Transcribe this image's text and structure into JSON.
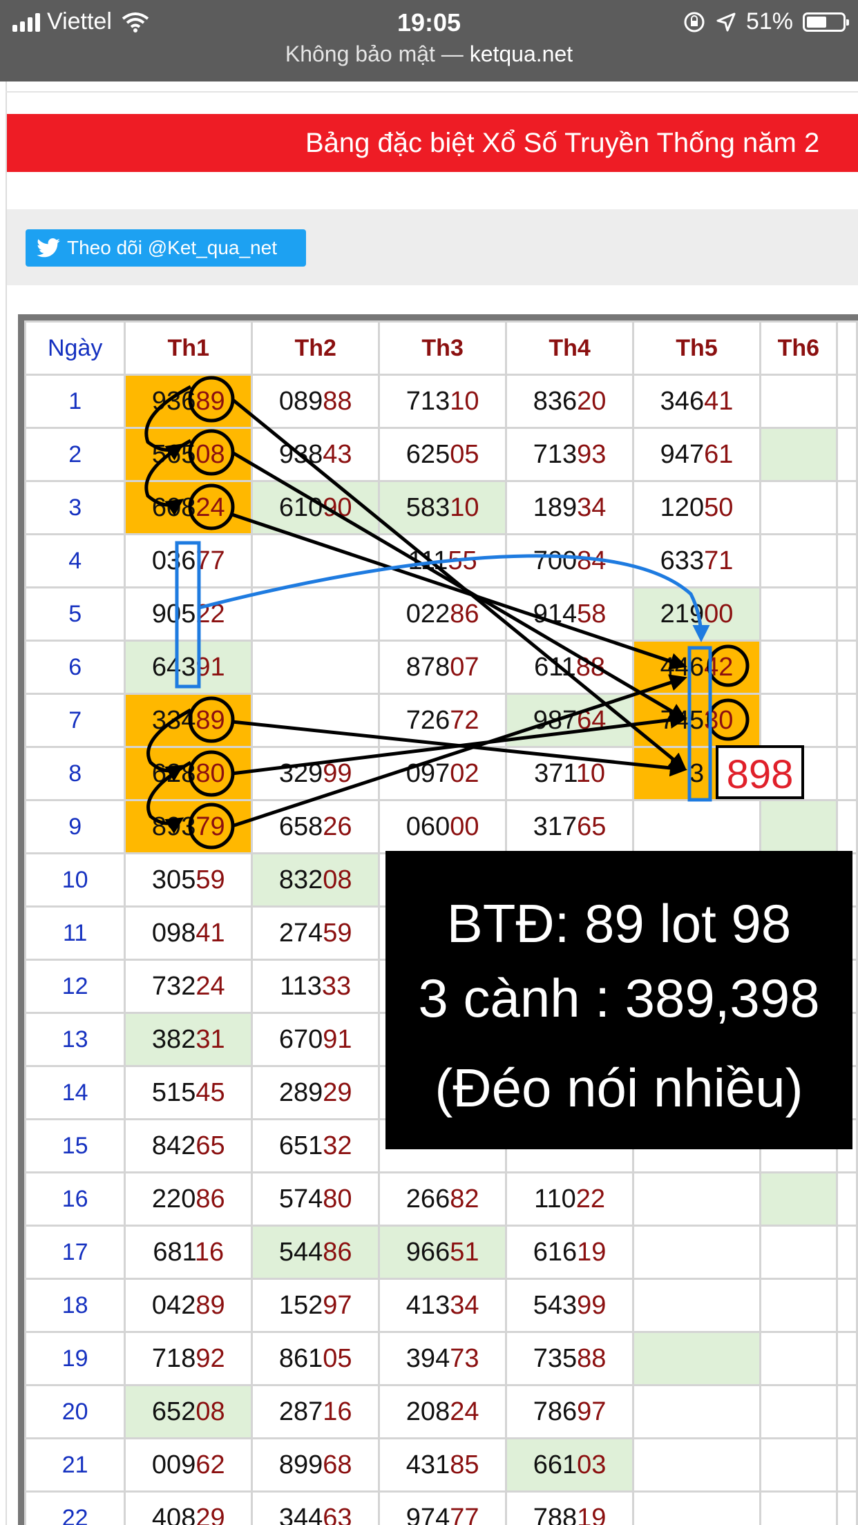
{
  "status_bar": {
    "carrier": "Viettel",
    "time": "19:05",
    "battery": "51%",
    "battery_level": 0.51
  },
  "address_bar": {
    "security": "Không bảo mật —",
    "domain": "ketqua.net"
  },
  "banner": {
    "title": "Bảng đặc biệt Xổ Số Truyền Thống năm 2"
  },
  "follow_button": {
    "label": "Theo dõi @Ket_qua_net"
  },
  "table": {
    "headers": [
      "Ngày",
      "Th1",
      "Th2",
      "Th3",
      "Th4",
      "Th5",
      "Th6"
    ],
    "rows": [
      {
        "day": "1",
        "cells": [
          [
            "936",
            "89",
            "orange"
          ],
          [
            "089",
            "88",
            ""
          ],
          [
            "713",
            "10",
            ""
          ],
          [
            "836",
            "20",
            ""
          ],
          [
            "346",
            "41",
            ""
          ],
          [
            "",
            "",
            ""
          ]
        ]
      },
      {
        "day": "2",
        "cells": [
          [
            "565",
            "08",
            "orange"
          ],
          [
            "938",
            "43",
            ""
          ],
          [
            "625",
            "05",
            ""
          ],
          [
            "713",
            "93",
            ""
          ],
          [
            "947",
            "61",
            ""
          ],
          [
            "",
            "",
            "green"
          ]
        ]
      },
      {
        "day": "3",
        "cells": [
          [
            "608",
            "24",
            "orange"
          ],
          [
            "610",
            "90",
            "green"
          ],
          [
            "583",
            "10",
            "green"
          ],
          [
            "189",
            "34",
            ""
          ],
          [
            "120",
            "50",
            ""
          ],
          [
            "",
            "",
            ""
          ]
        ]
      },
      {
        "day": "4",
        "cells": [
          [
            "036",
            "77",
            ""
          ],
          [
            "",
            "",
            ""
          ],
          [
            "111",
            "55",
            ""
          ],
          [
            "700",
            "84",
            ""
          ],
          [
            "633",
            "71",
            ""
          ],
          [
            "",
            "",
            ""
          ]
        ]
      },
      {
        "day": "5",
        "cells": [
          [
            "905",
            "22",
            ""
          ],
          [
            "",
            "",
            ""
          ],
          [
            "022",
            "86",
            ""
          ],
          [
            "914",
            "58",
            ""
          ],
          [
            "219",
            "00",
            "green"
          ],
          [
            "",
            "",
            ""
          ]
        ]
      },
      {
        "day": "6",
        "cells": [
          [
            "643",
            "91",
            "green"
          ],
          [
            "",
            "",
            ""
          ],
          [
            "878",
            "07",
            ""
          ],
          [
            "611",
            "88",
            ""
          ],
          [
            "446",
            "42",
            "orange"
          ],
          [
            "",
            "",
            ""
          ]
        ]
      },
      {
        "day": "7",
        "cells": [
          [
            "334",
            "89",
            "orange"
          ],
          [
            "",
            "",
            ""
          ],
          [
            "726",
            "72",
            ""
          ],
          [
            "987",
            "64",
            "green"
          ],
          [
            "745",
            "30",
            "orange"
          ],
          [
            "",
            "",
            ""
          ]
        ]
      },
      {
        "day": "8",
        "cells": [
          [
            "628",
            "80",
            "orange"
          ],
          [
            "329",
            "99",
            ""
          ],
          [
            "097",
            "02",
            ""
          ],
          [
            "371",
            "10",
            ""
          ],
          [
            "3",
            "",
            "orange"
          ],
          [
            "",
            "",
            ""
          ]
        ]
      },
      {
        "day": "9",
        "cells": [
          [
            "893",
            "79",
            "orange"
          ],
          [
            "658",
            "26",
            ""
          ],
          [
            "060",
            "00",
            ""
          ],
          [
            "317",
            "65",
            ""
          ],
          [
            "",
            "",
            ""
          ],
          [
            "",
            "",
            "green"
          ]
        ]
      },
      {
        "day": "10",
        "cells": [
          [
            "305",
            "59",
            ""
          ],
          [
            "832",
            "08",
            "green"
          ],
          [
            "",
            "",
            ""
          ],
          [
            "",
            "",
            ""
          ],
          [
            "",
            "",
            ""
          ],
          [
            "",
            "",
            ""
          ]
        ]
      },
      {
        "day": "11",
        "cells": [
          [
            "098",
            "41",
            ""
          ],
          [
            "274",
            "59",
            ""
          ],
          [
            "",
            "",
            ""
          ],
          [
            "",
            "",
            ""
          ],
          [
            "",
            "",
            ""
          ],
          [
            "",
            "",
            ""
          ]
        ]
      },
      {
        "day": "12",
        "cells": [
          [
            "732",
            "24",
            ""
          ],
          [
            "113",
            "33",
            ""
          ],
          [
            "",
            "",
            ""
          ],
          [
            "",
            "",
            ""
          ],
          [
            "",
            "",
            ""
          ],
          [
            "",
            "",
            ""
          ]
        ]
      },
      {
        "day": "13",
        "cells": [
          [
            "382",
            "31",
            "green"
          ],
          [
            "670",
            "91",
            ""
          ],
          [
            "",
            "",
            ""
          ],
          [
            "",
            "",
            ""
          ],
          [
            "",
            "",
            ""
          ],
          [
            "",
            "",
            ""
          ]
        ]
      },
      {
        "day": "14",
        "cells": [
          [
            "515",
            "45",
            ""
          ],
          [
            "289",
            "29",
            ""
          ],
          [
            "",
            "",
            ""
          ],
          [
            "",
            "",
            ""
          ],
          [
            "",
            "",
            ""
          ],
          [
            "",
            "",
            ""
          ]
        ]
      },
      {
        "day": "15",
        "cells": [
          [
            "842",
            "65",
            ""
          ],
          [
            "651",
            "32",
            ""
          ],
          [
            "",
            "",
            ""
          ],
          [
            "",
            "",
            ""
          ],
          [
            "",
            "",
            ""
          ],
          [
            "",
            "",
            ""
          ]
        ]
      },
      {
        "day": "16",
        "cells": [
          [
            "220",
            "86",
            ""
          ],
          [
            "574",
            "80",
            ""
          ],
          [
            "266",
            "82",
            ""
          ],
          [
            "110",
            "22",
            ""
          ],
          [
            "",
            "",
            ""
          ],
          [
            "",
            "",
            "green"
          ]
        ]
      },
      {
        "day": "17",
        "cells": [
          [
            "681",
            "16",
            ""
          ],
          [
            "544",
            "86",
            "green"
          ],
          [
            "966",
            "51",
            "green"
          ],
          [
            "616",
            "19",
            ""
          ],
          [
            "",
            "",
            ""
          ],
          [
            "",
            "",
            ""
          ]
        ]
      },
      {
        "day": "18",
        "cells": [
          [
            "042",
            "89",
            ""
          ],
          [
            "152",
            "97",
            ""
          ],
          [
            "413",
            "34",
            ""
          ],
          [
            "543",
            "99",
            ""
          ],
          [
            "",
            "",
            ""
          ],
          [
            "",
            "",
            ""
          ]
        ]
      },
      {
        "day": "19",
        "cells": [
          [
            "718",
            "92",
            ""
          ],
          [
            "861",
            "05",
            ""
          ],
          [
            "394",
            "73",
            ""
          ],
          [
            "735",
            "88",
            ""
          ],
          [
            "",
            "",
            "green"
          ],
          [
            "",
            "",
            ""
          ]
        ]
      },
      {
        "day": "20",
        "cells": [
          [
            "652",
            "08",
            "green"
          ],
          [
            "287",
            "16",
            ""
          ],
          [
            "208",
            "24",
            ""
          ],
          [
            "786",
            "97",
            ""
          ],
          [
            "",
            "",
            ""
          ],
          [
            "",
            "",
            ""
          ]
        ]
      },
      {
        "day": "21",
        "cells": [
          [
            "009",
            "62",
            ""
          ],
          [
            "899",
            "68",
            ""
          ],
          [
            "431",
            "85",
            ""
          ],
          [
            "661",
            "03",
            "green"
          ],
          [
            "",
            "",
            ""
          ],
          [
            "",
            "",
            ""
          ]
        ]
      },
      {
        "day": "22",
        "cells": [
          [
            "408",
            "29",
            ""
          ],
          [
            "344",
            "63",
            ""
          ],
          [
            "974",
            "77",
            ""
          ],
          [
            "788",
            "19",
            ""
          ],
          [
            "",
            "",
            ""
          ],
          [
            "",
            "",
            ""
          ]
        ]
      }
    ]
  },
  "annotation": {
    "line1": "BTĐ: 89 lot 98",
    "line2": "3 cành : 389,398",
    "line3": "(Đéo nói nhiều)",
    "result": "898"
  },
  "colors": {
    "banner": "#ee1c25",
    "highlight": "#ffb800",
    "green_cell": "#dff0d8",
    "twitter": "#1da1f2",
    "arrow_blue": "#1e7be0",
    "result_red": "#e0202a"
  }
}
